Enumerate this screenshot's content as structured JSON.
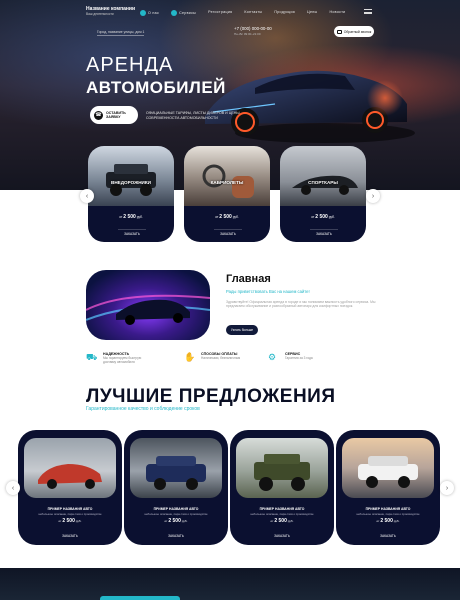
{
  "header": {
    "logo_title": "Название компании",
    "logo_sub": "Ваш деятельности",
    "nav": [
      "О нас",
      "Сервисы",
      "Регистрация",
      "Контакты",
      "Продукция",
      "Цены",
      "Новости"
    ],
    "address": "Город, название улицы, дом 1",
    "phone": "+7 (000) 000-00-00",
    "phone_sub": "Пн–Вс 09:00–21:00",
    "callback_label": "Обратный звонок"
  },
  "hero": {
    "title_line1": "АРЕНДА",
    "title_line2": "АВТОМОБИЛЕЙ",
    "order_label_1": "ОСТАВИТЬ",
    "order_label_2": "ЗАЯВКУ",
    "description": "ОФИЦИАЛЬНЫЕ ТАРИФЫ, ЛИСТЫ ДИЛЕРОВ И ЦЕНЫ СОВРЕМЕННОСТИ-АВТОМОБИЛЬНОСТИ"
  },
  "categories": [
    {
      "name": "ВНЕДОРОЖНИКИ",
      "price_prefix": "от",
      "price": "2 500",
      "unit": "руб.",
      "button": "ЗАКАЗАТЬ"
    },
    {
      "name": "КАБРИОЛЕТЫ",
      "price_prefix": "от",
      "price": "2 500",
      "unit": "руб.",
      "button": "ЗАКАЗАТЬ"
    },
    {
      "name": "СПОРТКАРЫ",
      "price_prefix": "от",
      "price": "2 500",
      "unit": "руб.",
      "button": "ЗАКАЗАТЬ"
    }
  ],
  "about": {
    "title": "Главная",
    "subtitle": "Рады приветствовать Вас на нашем сайте!",
    "text": "Здравствуйте! Официальная аренда в городе и мы понимаем важность удобного сервиса. Мы предлагаем обслуживание и разнообразный автопарк для комфортных поездок.",
    "button": "Узнать больше"
  },
  "features": [
    {
      "icon": "car-icon",
      "title": "НАДЕЖНОСТЬ",
      "desc": "Мы гарантируем быструю доставку автомобиля"
    },
    {
      "icon": "payment-icon",
      "title": "СПОСОБЫ ОПЛАТЫ",
      "desc": "Наличными, безналичным"
    },
    {
      "icon": "service-icon",
      "title": "СЕРВИС",
      "desc": "Гарантия за 3 года"
    }
  ],
  "best": {
    "title": "ЛУЧШИЕ ПРЕДЛОЖЕНИЯ",
    "subtitle": "Гарантированное качество и соблюдение сроков"
  },
  "offers": [
    {
      "name": "ПРИМЕР НАЗВАНИЯ АВТО",
      "desc": "небольшое описание, пара слов о производстве",
      "price_prefix": "от",
      "price": "2 500",
      "unit": "руб.",
      "button": "ЗАКАЗАТЬ"
    },
    {
      "name": "ПРИМЕР НАЗВАНИЯ АВТО",
      "desc": "небольшое описание, пара слов о производстве",
      "price_prefix": "от",
      "price": "2 500",
      "unit": "руб.",
      "button": "ЗАКАЗАТЬ"
    },
    {
      "name": "ПРИМЕР НАЗВАНИЯ АВТО",
      "desc": "небольшое описание, пара слов о производстве",
      "price_prefix": "от",
      "price": "2 500",
      "unit": "руб.",
      "button": "ЗАКАЗАТЬ"
    },
    {
      "name": "ПРИМЕР НАЗВАНИЯ АВТО",
      "desc": "небольшое описание, пара слов о производстве",
      "price_prefix": "от",
      "price": "2 500",
      "unit": "руб.",
      "button": "ЗАКАЗАТЬ"
    }
  ],
  "colors": {
    "accent": "#23b7c8",
    "dark": "#0b1030"
  }
}
